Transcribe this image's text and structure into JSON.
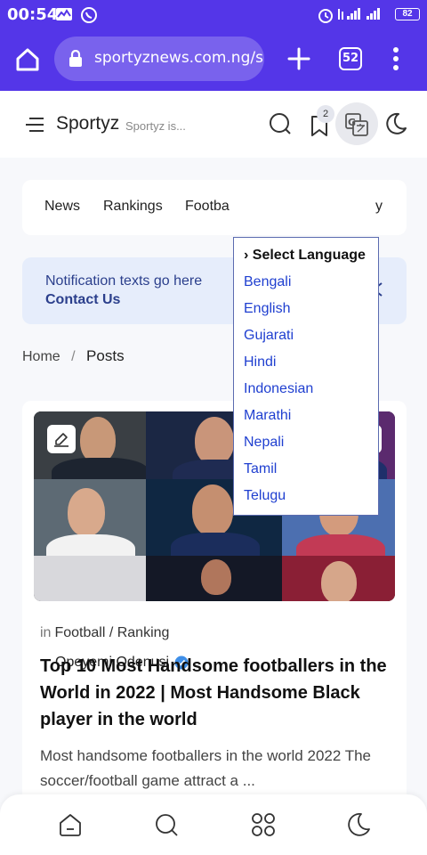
{
  "status_bar": {
    "time": "00:54",
    "battery": "82",
    "icons": [
      "activity-icon",
      "whatsapp-icon",
      "alarm-icon",
      "data-icon",
      "signal-icon",
      "battery-icon"
    ]
  },
  "browser": {
    "url": "sportyznews.com.ng/se",
    "tab_count": "52",
    "icons": [
      "home-icon",
      "lock-icon",
      "plus-icon",
      "tabs-icon",
      "more-icon"
    ],
    "accent": "#5436e8"
  },
  "site_header": {
    "brand": "Sportyz",
    "tagline": "Sportyz is...",
    "bookmark_count": "2"
  },
  "nav": {
    "items": [
      "News",
      "Rankings",
      "Footba",
      "y"
    ]
  },
  "notice": {
    "text": "Notification texts go here",
    "link": "Contact Us"
  },
  "breadcrumb": {
    "home": "Home",
    "separator": "/",
    "current": "Posts"
  },
  "language_dropdown": {
    "title": "› Select Language",
    "languages": [
      "Bengali",
      "English",
      "Gujarati",
      "Hindi",
      "Indonesian",
      "Marathi",
      "Nepali",
      "Tamil",
      "Telugu"
    ],
    "link_color": "#1f3fd0"
  },
  "post": {
    "author": "Opeyemi Odenusi",
    "category_prefix": "in",
    "category": "Football / Ranking",
    "title": "Top 10 Most Handsome footballers in the World in 2022 | Most Handsome Black player in the world",
    "excerpt": "Most handsome footballers in the world 2022 The soccer/football game attract a ..."
  },
  "bottom_nav": {
    "icons": [
      "home-icon",
      "search-icon",
      "apps-icon",
      "moon-icon"
    ]
  }
}
